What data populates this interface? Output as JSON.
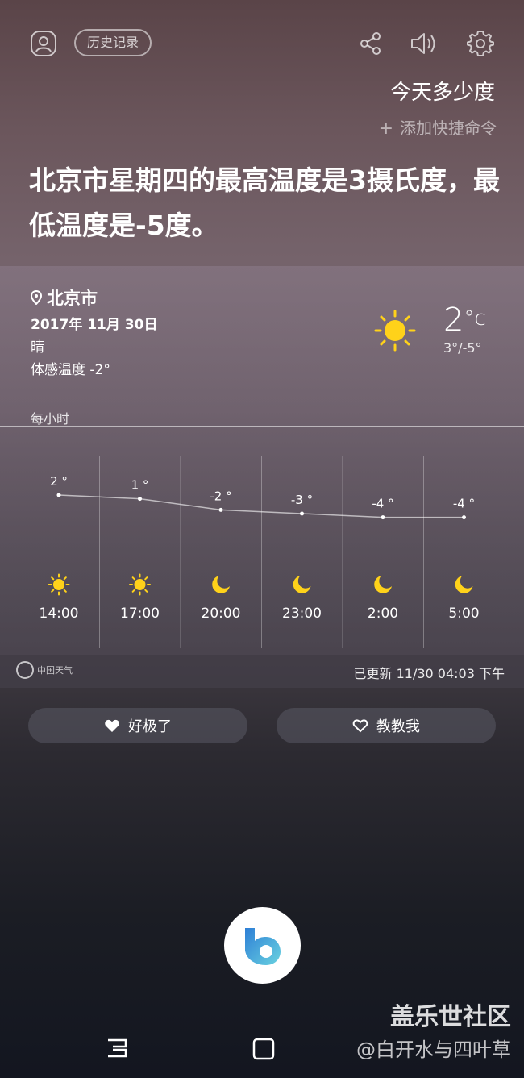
{
  "top": {
    "history_label": "历史记录",
    "query": "今天多少度",
    "add_shortcut_label": "添加快捷命令"
  },
  "answer": "北京市星期四的最高温度是3摄氏度，最低温度是-5度。",
  "weather": {
    "location": "北京市",
    "date": "2017年 11月 30日",
    "condition": "晴",
    "feels_like": "体感温度 -2°",
    "current_temp": "2",
    "unit": "°c",
    "hi_lo": "3°/-5°",
    "hourly_label": "每小时",
    "hourly": [
      {
        "time": "14:00",
        "temp": "2 °",
        "value": 2,
        "icon": "sun-icon"
      },
      {
        "time": "17:00",
        "temp": "1 °",
        "value": 1,
        "icon": "sun-icon"
      },
      {
        "time": "20:00",
        "temp": "-2 °",
        "value": -2,
        "icon": "moon-icon"
      },
      {
        "time": "23:00",
        "temp": "-3 °",
        "value": -3,
        "icon": "moon-icon"
      },
      {
        "time": "2:00",
        "temp": "-4 °",
        "value": -4,
        "icon": "moon-icon"
      },
      {
        "time": "5:00",
        "temp": "-4 °",
        "value": -4,
        "icon": "moon-icon"
      }
    ],
    "provider": "中国天气",
    "updated": "已更新   11/30 04:03 下午"
  },
  "feedback": {
    "like_label": "好极了",
    "teach_label": "教教我"
  },
  "watermark": {
    "line1": "盖乐世社区",
    "line2": "@白开水与四叶草"
  },
  "colors": {
    "sun": "#ffd21a",
    "moon": "#ffd21a",
    "bixby_gradient_start": "#2e7fd6",
    "bixby_gradient_end": "#69d2e0"
  }
}
